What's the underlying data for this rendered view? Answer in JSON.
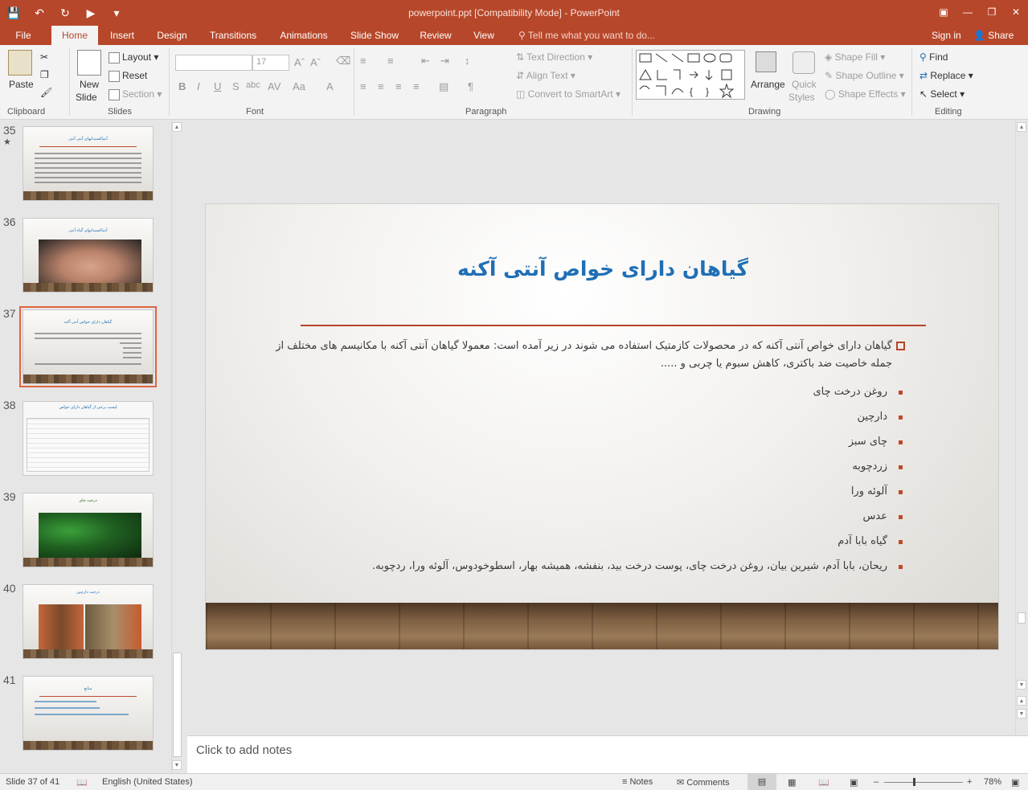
{
  "window": {
    "title": "powerpoint.ppt [Compatibility Mode] - PowerPoint"
  },
  "tabs": [
    {
      "label": "File"
    },
    {
      "label": "Home"
    },
    {
      "label": "Insert"
    },
    {
      "label": "Design"
    },
    {
      "label": "Transitions"
    },
    {
      "label": "Animations"
    },
    {
      "label": "Slide Show"
    },
    {
      "label": "Review"
    },
    {
      "label": "View"
    }
  ],
  "tell_me": "Tell me what you want to do...",
  "account": {
    "sign_in": "Sign in",
    "share": "Share"
  },
  "ribbon": {
    "clipboard": {
      "label": "Clipboard",
      "paste": "Paste"
    },
    "slides": {
      "label": "Slides",
      "new_slide_1": "New",
      "new_slide_2": "Slide",
      "layout": "Layout",
      "reset": "Reset",
      "section": "Section"
    },
    "font": {
      "label": "Font",
      "font_size": "17"
    },
    "paragraph": {
      "label": "Paragraph",
      "text_direction": "Text Direction",
      "align_text": "Align Text",
      "convert_smartart": "Convert to SmartArt"
    },
    "drawing": {
      "label": "Drawing",
      "arrange": "Arrange",
      "quick_styles_1": "Quick",
      "quick_styles_2": "Styles",
      "shape_fill": "Shape Fill",
      "shape_outline": "Shape Outline",
      "shape_effects": "Shape Effects"
    },
    "editing": {
      "label": "Editing",
      "find": "Find",
      "replace": "Replace",
      "select": "Select"
    }
  },
  "thumbnails": [
    {
      "number": "35",
      "title": "آنتیاکسیدانهای آنتی‌‌ آنتی"
    },
    {
      "number": "36",
      "title": "آنتیاکسیدانهای گیاه آنتی"
    },
    {
      "number": "37",
      "title": "گیاهان دارای خواص آنتی آکنه"
    },
    {
      "number": "38",
      "title": "لیست برخی از گیاهان دارای خواص"
    },
    {
      "number": "39",
      "title": "درخت چای"
    },
    {
      "number": "40",
      "title": "درخت دارچین"
    },
    {
      "number": "41",
      "title": "منابع"
    }
  ],
  "slide": {
    "title": "گیاهان دارای خواص آنتی آکنه",
    "intro": "گیاهان دارای خواص آنتی آکنه که در محصولات کازمتیک استفاده می شوند در زیر آمده است: معمولا گیاهان آنتی آکنه با مکانیسم های مختلف از جمله خاصیت ضد باکتری، کاهش سبوم یا چربی و .....",
    "bullets": [
      "روغن درخت چای",
      "دارچین",
      "چای سبز",
      "زردچوبه",
      "آلوئه ورا",
      "عدس",
      "گیاه بابا آدم",
      "ریحان، بابا آدم، شیرین بیان، روغن درخت چای، پوست درخت بید، بنفشه، همیشه بهار، اسطوخودوس، آلوئه ورا، ردچوبه."
    ]
  },
  "notes_placeholder": "Click to add notes",
  "status": {
    "slide_info": "Slide 37 of 41",
    "language": "English (United States)",
    "notes": "Notes",
    "comments": "Comments",
    "zoom": "78%"
  },
  "colors": {
    "accent": "#b7472a",
    "title_blue": "#1f6fb5",
    "bullet_red": "#c0482b"
  }
}
